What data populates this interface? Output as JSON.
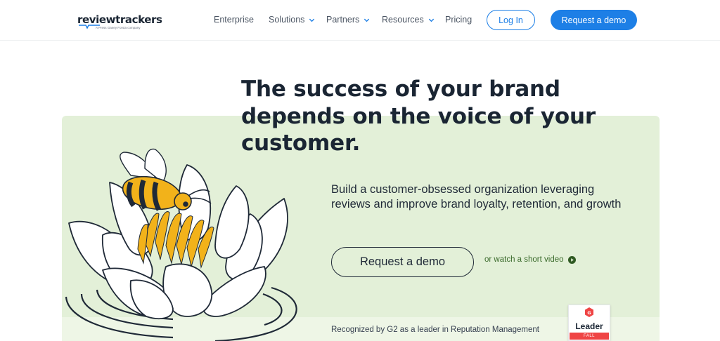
{
  "header": {
    "logo": {
      "wordmark": "reviewtrackers",
      "tagline": "A Press Ganey Forsta company"
    },
    "nav": [
      {
        "label": "Enterprise",
        "has_dropdown": false
      },
      {
        "label": "Solutions",
        "has_dropdown": true
      },
      {
        "label": "Partners",
        "has_dropdown": true
      },
      {
        "label": "Resources",
        "has_dropdown": true
      },
      {
        "label": "Pricing",
        "has_dropdown": false
      }
    ],
    "login_label": "Log In",
    "demo_label": "Request a demo"
  },
  "hero": {
    "headline": "The success of your brand depends on the voice of your customer.",
    "subtext": "Build a customer-obsessed organization leveraging reviews and improve brand loyalty, retention, and growth",
    "demo_label": "Request a demo",
    "video_link": "or watch a short video",
    "recognition": "Recognized by G2 as a leader in Reputation Management",
    "badge": {
      "title": "Leader",
      "season": "FALL"
    }
  },
  "colors": {
    "brand_blue": "#1d7fe6",
    "hero_green": "#e3f0d8",
    "text_dark": "#1a2533",
    "link_green": "#3b6b2c",
    "bee_yellow": "#f2b21a",
    "g2_red": "#ef4444"
  },
  "icons": {
    "dropdown": "chevron-down-icon",
    "video": "play-circle-icon",
    "badge": "g2-logo-icon"
  }
}
